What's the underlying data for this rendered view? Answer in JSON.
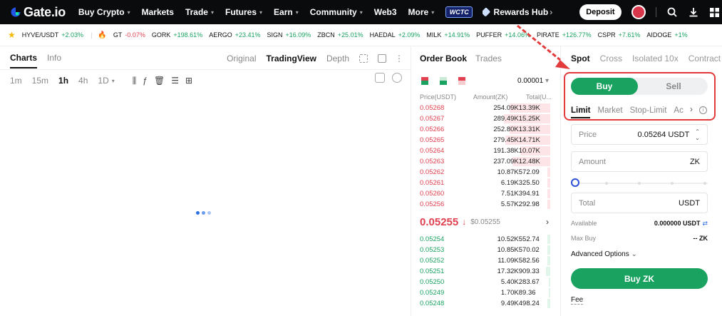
{
  "nav": {
    "logo_text": "Gate.io",
    "items": [
      {
        "label": "Buy Crypto",
        "has_menu": true
      },
      {
        "label": "Markets",
        "has_menu": false
      },
      {
        "label": "Trade",
        "has_menu": true
      },
      {
        "label": "Futures",
        "has_menu": true
      },
      {
        "label": "Earn",
        "has_menu": true
      },
      {
        "label": "Community",
        "has_menu": true
      },
      {
        "label": "Web3",
        "has_menu": false
      },
      {
        "label": "More",
        "has_menu": true
      }
    ],
    "badge_text": "WCTC",
    "rewards_label": "Rewards Hub",
    "deposit_label": "Deposit"
  },
  "ticker": [
    {
      "symbol": "HYVE/USDT",
      "change": "+2.03%",
      "dir": "up"
    },
    {
      "symbol": "GT",
      "change": "-0.07%",
      "dir": "dn"
    },
    {
      "symbol": "GORK",
      "change": "+198.61%",
      "dir": "up"
    },
    {
      "symbol": "AERGO",
      "change": "+23.41%",
      "dir": "up"
    },
    {
      "symbol": "SIGN",
      "change": "+16.09%",
      "dir": "up"
    },
    {
      "symbol": "ZBCN",
      "change": "+25.01%",
      "dir": "up"
    },
    {
      "symbol": "HAEDAL",
      "change": "+2.09%",
      "dir": "up"
    },
    {
      "symbol": "MILK",
      "change": "+14.91%",
      "dir": "up"
    },
    {
      "symbol": "PUFFER",
      "change": "+14.06%",
      "dir": "up"
    },
    {
      "symbol": "PIRATE",
      "change": "+126.77%",
      "dir": "up"
    },
    {
      "symbol": "CSPR",
      "change": "+7.61%",
      "dir": "up"
    },
    {
      "symbol": "AIDOGE",
      "change": "+1%",
      "dir": "up"
    }
  ],
  "chart_panel": {
    "tabs": [
      "Charts",
      "Info"
    ],
    "views": [
      "Original",
      "TradingView",
      "Depth"
    ],
    "active_view": "TradingView",
    "timeframes": [
      "1m",
      "15m",
      "1h",
      "4h",
      "1D"
    ],
    "active_timeframe": "1h"
  },
  "orderbook": {
    "tabs": [
      "Order Book",
      "Trades"
    ],
    "precision": "0.00001",
    "headers": [
      "Price(USDT)",
      "Amount(ZK)",
      "Total(U..."
    ],
    "asks": [
      {
        "price": "0.05268",
        "amount": "254.09K",
        "total": "13.39K",
        "depth": 0.3
      },
      {
        "price": "0.05267",
        "amount": "289.49K",
        "total": "15.25K",
        "depth": 0.34
      },
      {
        "price": "0.05266",
        "amount": "252.80K",
        "total": "13.31K",
        "depth": 0.3
      },
      {
        "price": "0.05265",
        "amount": "279.45K",
        "total": "14.71K",
        "depth": 0.33
      },
      {
        "price": "0.05264",
        "amount": "191.38K",
        "total": "10.07K",
        "depth": 0.22
      },
      {
        "price": "0.05263",
        "amount": "237.09K",
        "total": "12.48K",
        "depth": 0.28
      },
      {
        "price": "0.05262",
        "amount": "10.87K",
        "total": "572.09",
        "depth": 0.02
      },
      {
        "price": "0.05261",
        "amount": "6.19K",
        "total": "325.50",
        "depth": 0.02
      },
      {
        "price": "0.05260",
        "amount": "7.51K",
        "total": "394.91",
        "depth": 0.02
      },
      {
        "price": "0.05256",
        "amount": "5.57K",
        "total": "292.98",
        "depth": 0.02
      }
    ],
    "last_price": "0.05255",
    "last_price_usd": "$0.05255",
    "bids": [
      {
        "price": "0.05254",
        "amount": "10.52K",
        "total": "552.74",
        "depth": 0.02
      },
      {
        "price": "0.05253",
        "amount": "10.85K",
        "total": "570.02",
        "depth": 0.02
      },
      {
        "price": "0.05252",
        "amount": "11.09K",
        "total": "582.56",
        "depth": 0.02
      },
      {
        "price": "0.05251",
        "amount": "17.32K",
        "total": "909.33",
        "depth": 0.03
      },
      {
        "price": "0.05250",
        "amount": "5.40K",
        "total": "283.67",
        "depth": 0.01
      },
      {
        "price": "0.05249",
        "amount": "1.70K",
        "total": "89.36",
        "depth": 0.01
      },
      {
        "price": "0.05248",
        "amount": "9.49K",
        "total": "498.24",
        "depth": 0.02
      }
    ]
  },
  "trade": {
    "tabs": [
      "Spot",
      "Cross",
      "Isolated 10x",
      "Contract"
    ],
    "buy_label": "Buy",
    "sell_label": "Sell",
    "order_types": [
      "Limit",
      "Market",
      "Stop-Limit",
      "Ac"
    ],
    "price_label": "Price",
    "price_value": "0.05264 USDT",
    "amount_label": "Amount",
    "amount_unit": "ZK",
    "total_label": "Total",
    "total_unit": "USDT",
    "available_label": "Available",
    "available_value": "0.000000 USDT",
    "maxbuy_label": "Max Buy",
    "maxbuy_value": "-- ZK",
    "advanced_label": "Advanced Options",
    "submit_label": "Buy ZK",
    "fee_label": "Fee",
    "colors": {
      "buy": "#1aa260",
      "sell": "#e0404f",
      "highlight": "#e33b3b"
    }
  }
}
